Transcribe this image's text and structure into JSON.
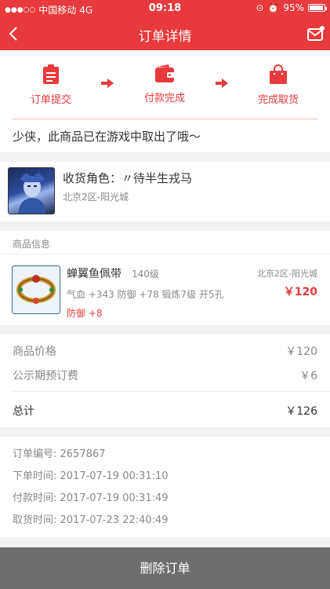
{
  "status_bar": {
    "carrier": "中国移动",
    "network": "4G",
    "time": "09:18",
    "battery": "95%"
  },
  "nav": {
    "title": "订单详情"
  },
  "progress": {
    "steps": [
      {
        "label": "订单提交",
        "icon": "clipboard-icon"
      },
      {
        "label": "付款完成",
        "icon": "wallet-icon"
      },
      {
        "label": "完成取货",
        "icon": "shopping-bag-icon"
      }
    ]
  },
  "notice": "少侠，此商品已在游戏中取出了哦～",
  "role": {
    "label": "收货角色：〃待半生戎马",
    "server": "北京2区-阳光城"
  },
  "goods": {
    "section_title": "商品信息",
    "name": "蝉翼鱼佩带",
    "level": "140级",
    "attributes": "气血 +343 防御 +78 锻炼7级 开5孔",
    "extra": "防御 +8",
    "server": "北京2区-阳光城",
    "price": "￥120"
  },
  "fees": {
    "goods_price_label": "商品价格",
    "goods_price": "￥120",
    "reserve_fee_label": "公示期预订费",
    "reserve_fee": "￥6",
    "total_label": "总计",
    "total": "￥126"
  },
  "order_info": {
    "order_no": "订单编号: 2657867",
    "order_time": "下单时间: 2017-07-19 00:31:10",
    "pay_time": "付款时间: 2017-07-19 00:31:49",
    "pickup_time": "取货时间: 2017-07-23 22:40:49"
  },
  "actions": {
    "delete_label": "删除订单"
  },
  "colors": {
    "accent": "#e8393c",
    "button": "#6e6e6e"
  }
}
